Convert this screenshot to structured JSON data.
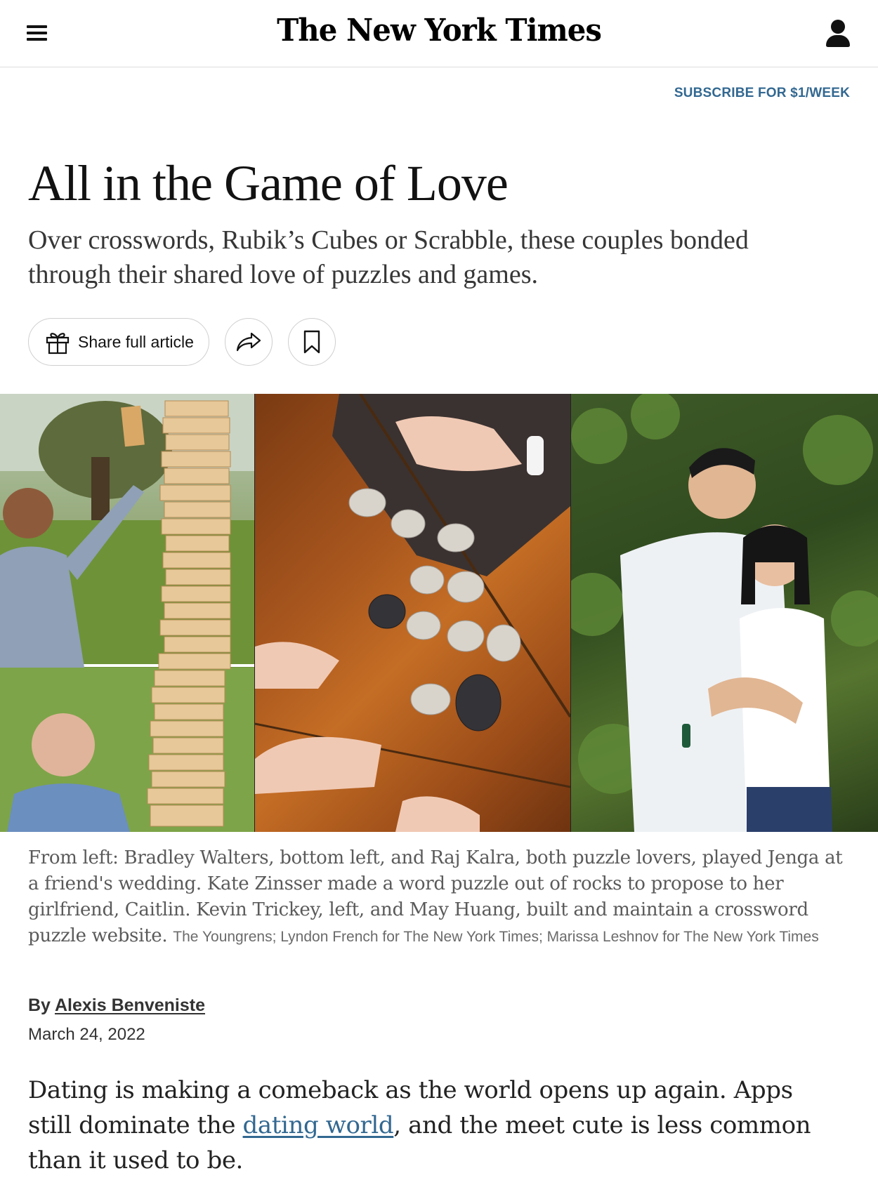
{
  "header": {
    "logo_text": "The New York Times",
    "icons": {
      "menu": "hamburger-menu-icon",
      "account": "user-account-icon"
    }
  },
  "subscribe": {
    "label": "SUBSCRIBE FOR $1/WEEK",
    "color": "#326891"
  },
  "article": {
    "headline": "All in the Game of Love",
    "summary": "Over crosswords, Rubik’s Cubes or Scrabble, these couples bonded through their shared love of puzzles and games.",
    "share": {
      "share_full_label": "Share full article",
      "icons": {
        "gift": "gift-icon",
        "share": "share-arrow-icon",
        "save": "bookmark-icon"
      }
    },
    "image": {
      "caption": "From left: Bradley Walters, bottom left, and Raj Kalra, both puzzle lovers, played Jenga at a friend's wedding. Kate Zinsser made a word puzzle out of rocks to propose to her girlfriend, Caitlin. Kevin Trickey, left, and May Huang, built and maintain a crossword puzzle website.",
      "credit": "The Youngrens; Lyndon French for The New York Times; Marissa Leshnov for The New York Times"
    },
    "byline": {
      "prefix": "By ",
      "author": "Alexis Benveniste"
    },
    "date": "March 24, 2022",
    "body": {
      "part1": "Dating is making a comeback as the world opens up again. Apps still dominate the ",
      "link": "dating world",
      "part2": ", and the meet cute is less common than it used to be."
    }
  }
}
